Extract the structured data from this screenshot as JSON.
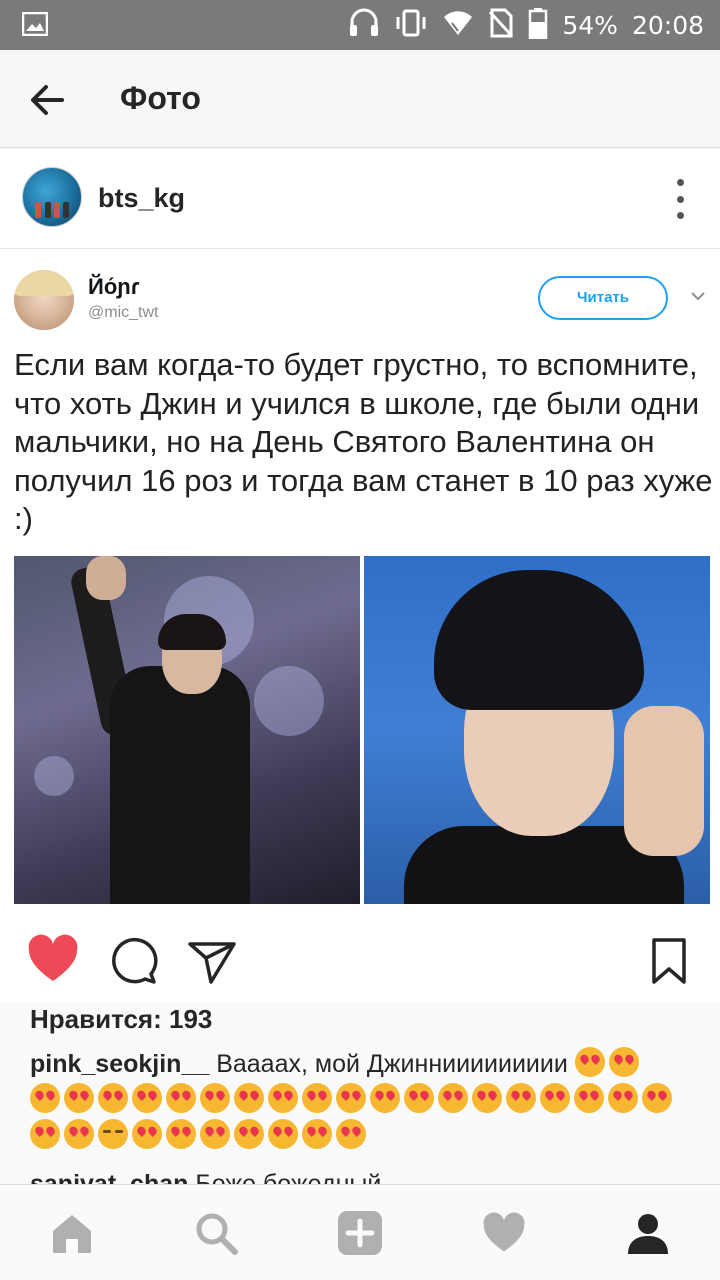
{
  "status_bar": {
    "battery": "54%",
    "time": "20:08",
    "icons": [
      "image-icon",
      "headset-icon",
      "vibrate-icon",
      "wifi-icon",
      "no-sim-icon",
      "battery-icon"
    ]
  },
  "app_bar": {
    "title": "Фото",
    "back_icon": "arrow-left-icon"
  },
  "post": {
    "username": "bts_kg",
    "more_icon": "vertical-dots-icon"
  },
  "tweet": {
    "name": "Йо́ɲɾ",
    "handle": "@mic_twt",
    "follow_label": "Читать",
    "text": "Если вам когда-то будет грустно, то вспомните, что хоть Джин и учился в школе, где были одни мальчики, но на День Святого Валентина он получил 16 роз и тогда вам станет в 10 раз хуже :)"
  },
  "actions": {
    "like_icon": "heart-filled-icon",
    "comment_icon": "comment-bubble-icon",
    "share_icon": "send-icon",
    "save_icon": "bookmark-icon",
    "like_color": "#ed4956"
  },
  "likes": {
    "label": "Нравится: 193"
  },
  "comments": [
    {
      "user": "pink_seokjin__",
      "text": "Вааaах, мой Джинниииииииии"
    },
    {
      "user": "sanivat_chan",
      "text": "Боже божедный"
    }
  ],
  "bottom_nav": {
    "items": [
      "home-icon",
      "search-icon",
      "add-icon",
      "heart-icon",
      "profile-icon"
    ]
  }
}
